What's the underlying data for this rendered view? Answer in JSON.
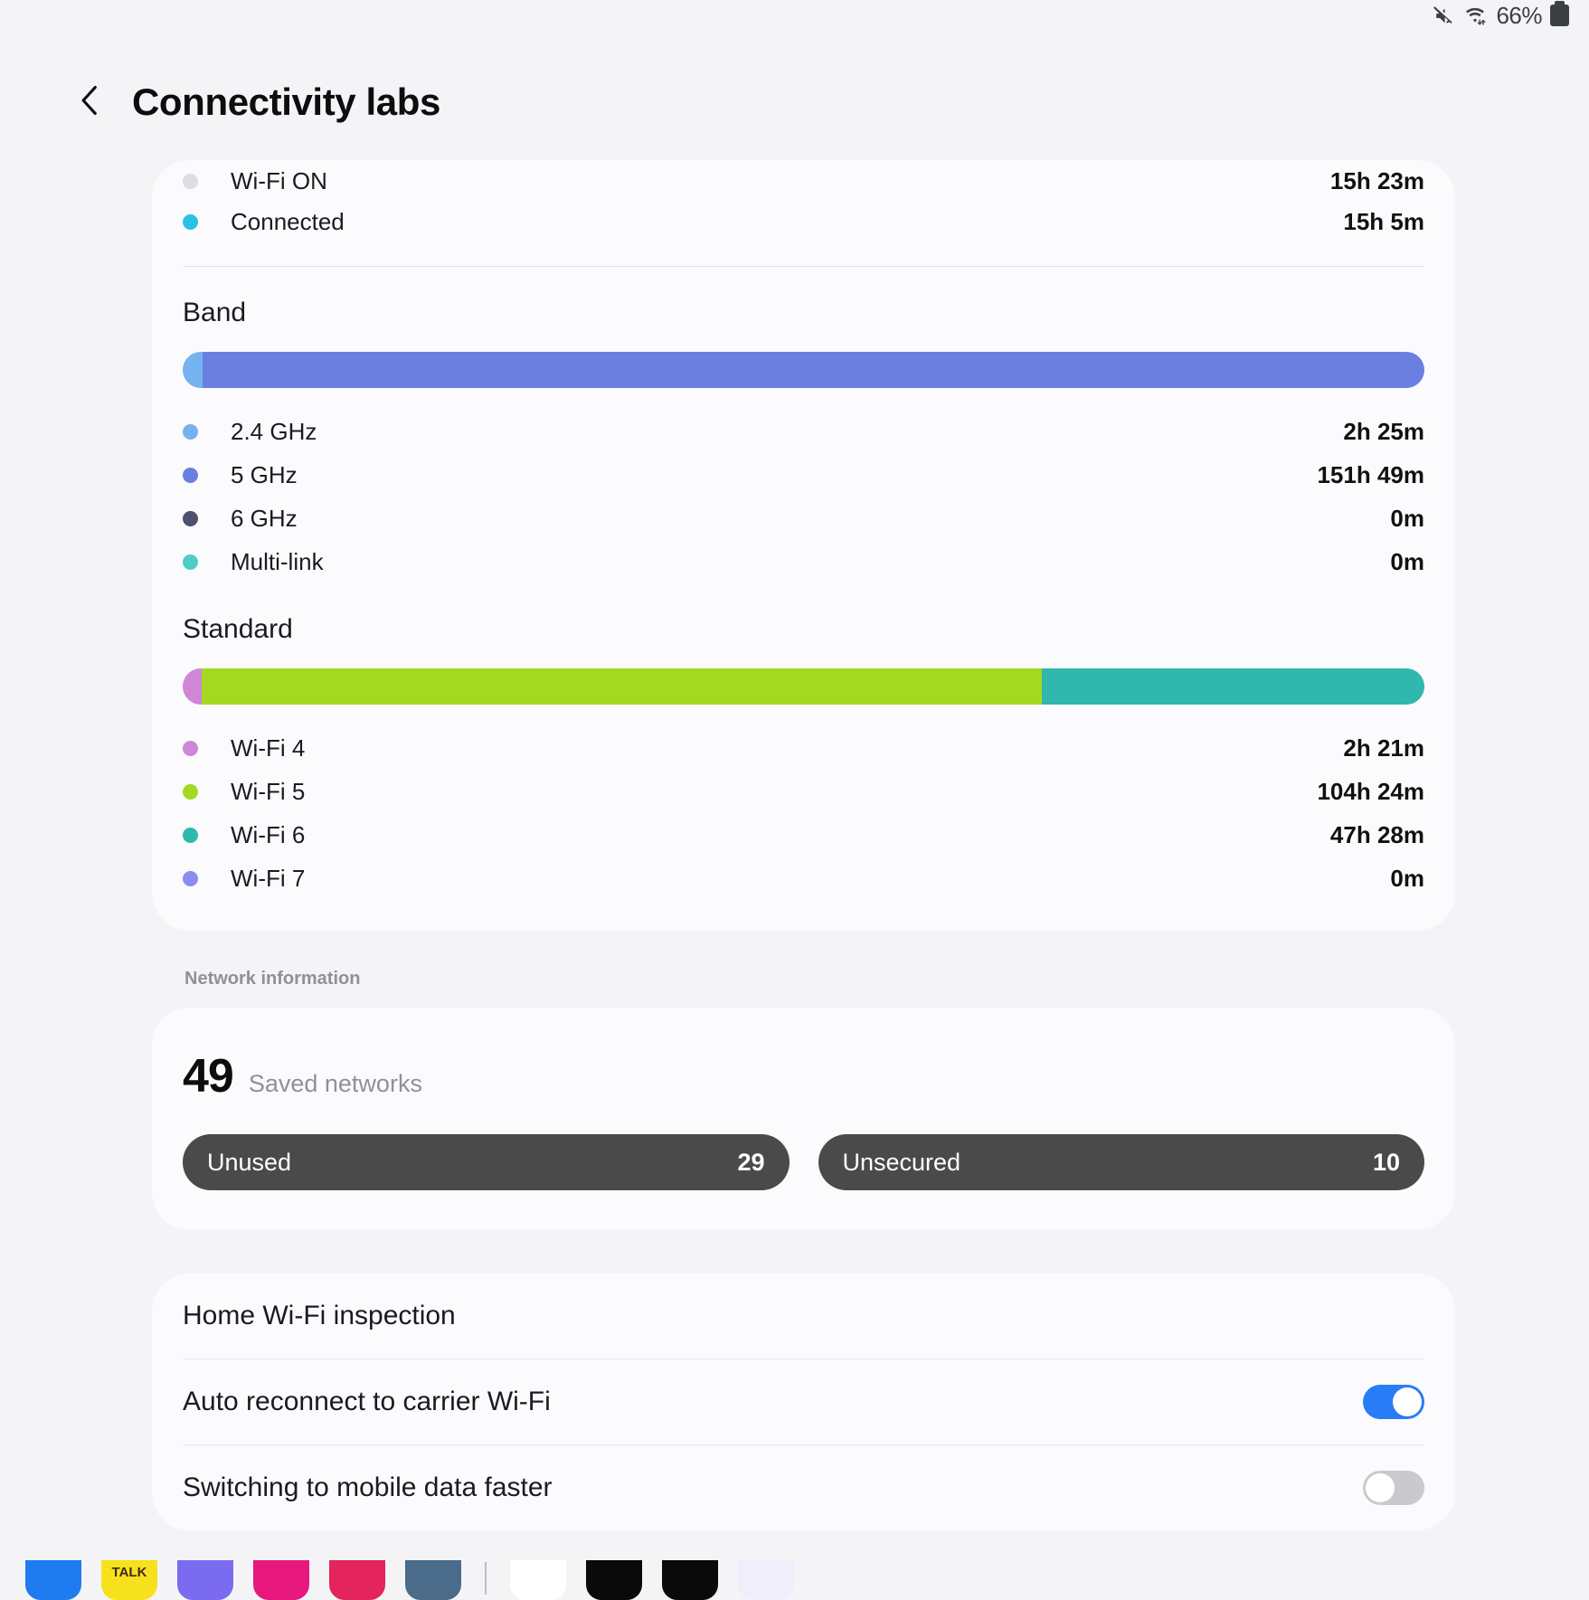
{
  "status_bar": {
    "mute_icon": "mute-icon",
    "wifi_icon": "wifi-transfer-icon",
    "battery_percent": "66%",
    "battery_icon": "battery-icon"
  },
  "header": {
    "back_icon": "chevron-left-icon",
    "title": "Connectivity labs"
  },
  "usage_card": {
    "status_rows": [
      {
        "label": "Wi-Fi ON",
        "value": "15h 23m",
        "color": "#dedee2"
      },
      {
        "label": "Connected",
        "value": "15h 5m",
        "color": "#2ac0e8"
      }
    ],
    "band": {
      "title": "Band",
      "items": [
        {
          "label": "2.4 GHz",
          "value": "2h 25m",
          "color": "#74b2f0",
          "pct": 1.6
        },
        {
          "label": "5 GHz",
          "value": "151h 49m",
          "color": "#6b7fe0",
          "pct": 98.4
        },
        {
          "label": "6 GHz",
          "value": "0m",
          "color": "#4f4f6e",
          "pct": 0
        },
        {
          "label": "Multi-link",
          "value": "0m",
          "color": "#4ecdc8",
          "pct": 0
        }
      ]
    },
    "standard": {
      "title": "Standard",
      "items": [
        {
          "label": "Wi-Fi 4",
          "value": "2h 21m",
          "color": "#cf86d8",
          "pct": 1.5
        },
        {
          "label": "Wi-Fi 5",
          "value": "104h 24m",
          "color": "#a4d922",
          "pct": 67.7
        },
        {
          "label": "Wi-Fi 6",
          "value": "47h 28m",
          "color": "#30b8ae",
          "pct": 30.8
        },
        {
          "label": "Wi-Fi 7",
          "value": "0m",
          "color": "#8f8cf0",
          "pct": 0
        }
      ]
    }
  },
  "network_information": {
    "caption": "Network information",
    "saved_count": "49",
    "saved_caption": "Saved networks",
    "chips": [
      {
        "label": "Unused",
        "value": "29"
      },
      {
        "label": "Unsecured",
        "value": "10"
      }
    ]
  },
  "settings": {
    "rows": [
      {
        "label": "Home Wi-Fi inspection",
        "type": "link"
      },
      {
        "label": "Auto reconnect to carrier Wi-Fi",
        "type": "toggle",
        "state": "on"
      },
      {
        "label": "Switching to mobile data faster",
        "type": "toggle",
        "state": "off"
      }
    ]
  },
  "dock": {
    "apps": [
      {
        "name": "messenger-app",
        "color": "#1f7bf0",
        "glyph": ""
      },
      {
        "name": "kakaotalk-app",
        "color": "#f7e11d",
        "glyph": ""
      },
      {
        "name": "samsung-internet-app",
        "color": "#7a6bf0",
        "glyph": ""
      },
      {
        "name": "gallery-app",
        "color": "#e8197e",
        "glyph": ""
      },
      {
        "name": "instagram-app",
        "color": "#e4245c",
        "glyph": ""
      },
      {
        "name": "settings-app",
        "color": "#4a6b8a",
        "glyph": ""
      },
      {
        "name": "openai-app",
        "color": "#ffffff",
        "glyph": ""
      },
      {
        "name": "x-app-one",
        "color": "#0a0a0a",
        "glyph": ""
      },
      {
        "name": "x-app-two",
        "color": "#0a0a0a",
        "glyph": ""
      },
      {
        "name": "gemini-app",
        "color": "#f0eefb",
        "glyph": ""
      }
    ]
  },
  "colors": {
    "page_bg": "#f4f4f6",
    "card_bg": "#fbfbfd",
    "accent_toggle_on": "#2a7cf6",
    "chip_bg": "#4a4a4a"
  },
  "chart_data": [
    {
      "type": "bar",
      "title": "Band",
      "orientation": "horizontal-stacked",
      "categories": [
        "2.4 GHz",
        "5 GHz",
        "6 GHz",
        "Multi-link"
      ],
      "values": [
        145,
        9109,
        0,
        0
      ],
      "value_labels": [
        "2h 25m",
        "151h 49m",
        "0m",
        "0m"
      ],
      "unit": "minutes",
      "colors": [
        "#74b2f0",
        "#6b7fe0",
        "#4f4f6e",
        "#4ecdc8"
      ],
      "total_minutes": 9254,
      "xlabel": "",
      "ylabel": "",
      "grid": false,
      "legend": "bottom"
    },
    {
      "type": "bar",
      "title": "Standard",
      "orientation": "horizontal-stacked",
      "categories": [
        "Wi-Fi 4",
        "Wi-Fi 5",
        "Wi-Fi 6",
        "Wi-Fi 7"
      ],
      "values": [
        141,
        6264,
        2848,
        0
      ],
      "value_labels": [
        "2h 21m",
        "104h 24m",
        "47h 28m",
        "0m"
      ],
      "unit": "minutes",
      "colors": [
        "#cf86d8",
        "#a4d922",
        "#30b8ae",
        "#8f8cf0"
      ],
      "total_minutes": 9253,
      "xlabel": "",
      "ylabel": "",
      "grid": false,
      "legend": "bottom"
    }
  ]
}
